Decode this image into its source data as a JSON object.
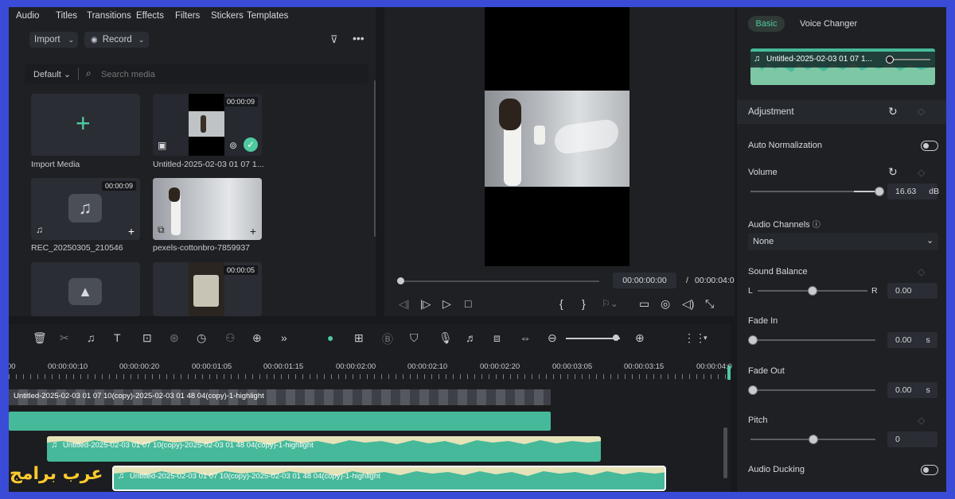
{
  "top_tabs": [
    "Audio",
    "Titles",
    "Transitions",
    "Effects",
    "Filters",
    "Stickers",
    "Templates"
  ],
  "media_toolbar": {
    "import_label": "Import",
    "record_label": "Record"
  },
  "media_filter": {
    "sort_label": "Default",
    "search_placeholder": "Search media"
  },
  "media_items": [
    {
      "caption": "Import Media",
      "duration": ""
    },
    {
      "caption": "Untitled-2025-02-03 01 07 1...",
      "duration": "00:00:09"
    },
    {
      "caption": "REC_20250305_210546",
      "duration": "00:00:09"
    },
    {
      "caption": "pexels-cottonbro-7859937",
      "duration": ""
    },
    {
      "caption": "",
      "duration": ""
    },
    {
      "caption": "",
      "duration": "00:00:05"
    }
  ],
  "preview": {
    "current_time": "00:00:00:00",
    "separator": "/",
    "total_time": "00:00:04:0"
  },
  "right_panel": {
    "tab_basic": "Basic",
    "tab_voice_changer": "Voice Changer",
    "clip_name": "Untitled-2025-02-03 01 07 1...",
    "adjustment_title": "Adjustment",
    "auto_normalization": "Auto Normalization",
    "volume_label": "Volume",
    "volume_value": "16.63",
    "volume_unit": "dB",
    "audio_channels_label": "Audio Channels",
    "audio_channels_value": "None",
    "sound_balance_label": "Sound Balance",
    "balance_left": "L",
    "balance_right": "R",
    "balance_value": "0.00",
    "fade_in_label": "Fade In",
    "fade_in_value": "0.00",
    "fade_in_unit": "s",
    "fade_out_label": "Fade Out",
    "fade_out_value": "0.00",
    "fade_out_unit": "s",
    "pitch_label": "Pitch",
    "pitch_value": "0",
    "audio_ducking_label": "Audio Ducking"
  },
  "ruler_ticks": [
    "00",
    "00:00:00:10",
    "00:00:00:20",
    "00:00:01:05",
    "00:00:01:15",
    "00:00:02:00",
    "00:00:02:10",
    "00:00:02:20",
    "00:00:03:05",
    "00:00:03:15",
    "00:00:04:0"
  ],
  "tracks": {
    "video_clip": "Untitled-2025-02-03 01 07 10(copy)-2025-02-03 01 48 04(copy)-1-highlight",
    "audio_clip_1": "Untitled-2025-02-03 01 07 10(copy)-2025-02-03 01 48 04(copy)-1-highlight",
    "audio_clip_2": "Untitled-2025-02-03 01 07 10(copy)-2025-02-03 01 48 04(copy)-1-highlight"
  },
  "watermark": "عرب برامج",
  "colors": {
    "accent": "#4ec9a0",
    "track_audio": "#46b99a",
    "waveform": "#e6e3b8",
    "frame_border": "#3a4bd8",
    "watermark": "#ffcb2e"
  }
}
